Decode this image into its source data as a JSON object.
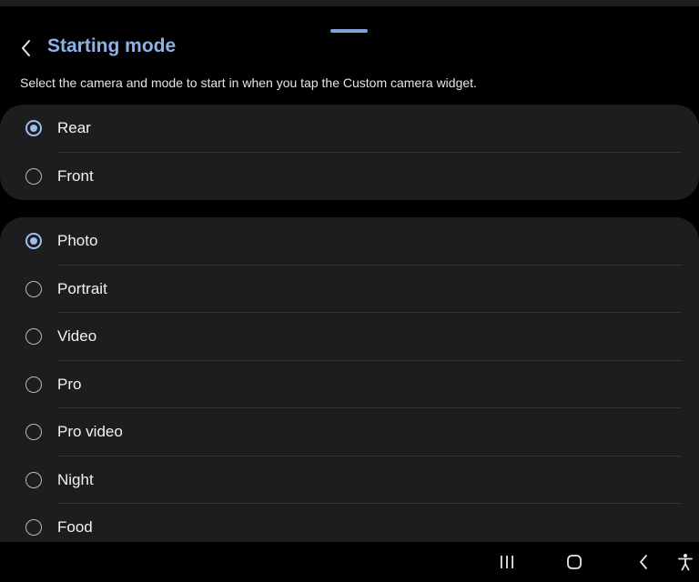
{
  "header": {
    "title": "Starting mode",
    "back_icon": "chevron-left-icon"
  },
  "description": "Select the camera and mode to start in when you tap the Custom camera widget.",
  "camera_options": [
    {
      "label": "Rear",
      "selected": true
    },
    {
      "label": "Front",
      "selected": false
    }
  ],
  "mode_options": [
    {
      "label": "Photo",
      "selected": true
    },
    {
      "label": "Portrait",
      "selected": false
    },
    {
      "label": "Video",
      "selected": false
    },
    {
      "label": "Pro",
      "selected": false
    },
    {
      "label": "Pro video",
      "selected": false
    },
    {
      "label": "Night",
      "selected": false
    },
    {
      "label": "Food",
      "selected": false
    }
  ],
  "nav_bar": {
    "icons": [
      "recent-apps-icon",
      "home-icon",
      "back-icon",
      "accessibility-icon"
    ]
  },
  "colors": {
    "accent": "#8fb2e6",
    "radio_selected": "#9dbdf0",
    "card_background": "#1d1d1f",
    "background": "#000000"
  }
}
